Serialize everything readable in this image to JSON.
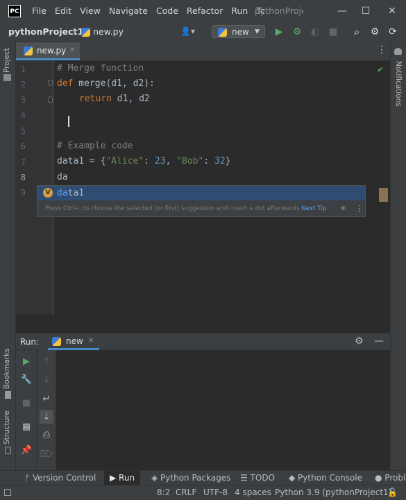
{
  "app": {
    "logo_text": "PC",
    "window_title": "pythonProjec"
  },
  "menu": {
    "items": [
      "File",
      "Edit",
      "View",
      "Navigate",
      "Code",
      "Refactor",
      "Run",
      "Tc"
    ]
  },
  "window_controls": {
    "minimize": "—",
    "maximize": "☐",
    "close": "✕"
  },
  "navbar": {
    "project": "pythonProject1",
    "separator": "〉",
    "file": "new.py",
    "run_config": "new",
    "run_config_arrow": "▼",
    "user_icon": "👤▾"
  },
  "toolbar_icons": {
    "run": "▶",
    "debug": "⚙",
    "coverage": "◐",
    "stop": "■",
    "search": "⌕",
    "settings": "⚙",
    "update": "⟳"
  },
  "left_stripe": {
    "project": "Project",
    "bookmarks": "Bookmarks",
    "structure": "Structure"
  },
  "right_stripe": {
    "notifications": "Notifications"
  },
  "editor": {
    "tab_label": "new.py",
    "tab_close": "✕",
    "tab_menu": "⋮",
    "line_numbers": [
      "1",
      "2",
      "3",
      "4",
      "5",
      "6",
      "7",
      "8",
      "9"
    ],
    "lines": {
      "l1": "# Merge function",
      "l2_kw": "def",
      "l2_rest": " merge(d1, d2):",
      "l3_kw": "return",
      "l3_rest": " d1, d2",
      "l6": "# Example code",
      "l7_a": "data1 = {",
      "l7_s1": "\"Alice\"",
      "l7_b": ": ",
      "l7_n1": "23",
      "l7_c": ", ",
      "l7_s2": "\"Bob\"",
      "l7_d": ": ",
      "l7_n2": "32",
      "l7_e": "}",
      "l8": "da"
    },
    "inspection_ok": "✔"
  },
  "completion": {
    "kind_badge": "V",
    "typed": "da",
    "suggestion_rest": "ta1",
    "hint": "Press Ctrl+. to choose the selected (or first) suggestion and insert a dot afterwards",
    "tip": "Next Tip",
    "spinner": "✳",
    "more": "⋮"
  },
  "run_panel": {
    "title": "Run:",
    "tab": "new",
    "tab_close": "✕",
    "gear": "⚙",
    "minimize": "—",
    "tools": {
      "rerun": "▶",
      "modify": "🔧",
      "stop": "■",
      "layout": "▦",
      "pin": "📌",
      "up": "↑",
      "down": "↓",
      "wrap": "↵",
      "scroll_end": "⇣",
      "print": "⎙",
      "delete": "⌦"
    }
  },
  "tool_tabs": {
    "version_control": "Version Control",
    "run": "Run",
    "python_packages": "Python Packages",
    "todo": "TODO",
    "python_console": "Python Console",
    "problems": "Probl"
  },
  "status": {
    "position": "8:2",
    "line_sep": "CRLF",
    "encoding": "UTF-8",
    "indent": "4 spaces",
    "interpreter": "Python 3.9 (pythonProject1)",
    "lock_icon": "🔓"
  }
}
